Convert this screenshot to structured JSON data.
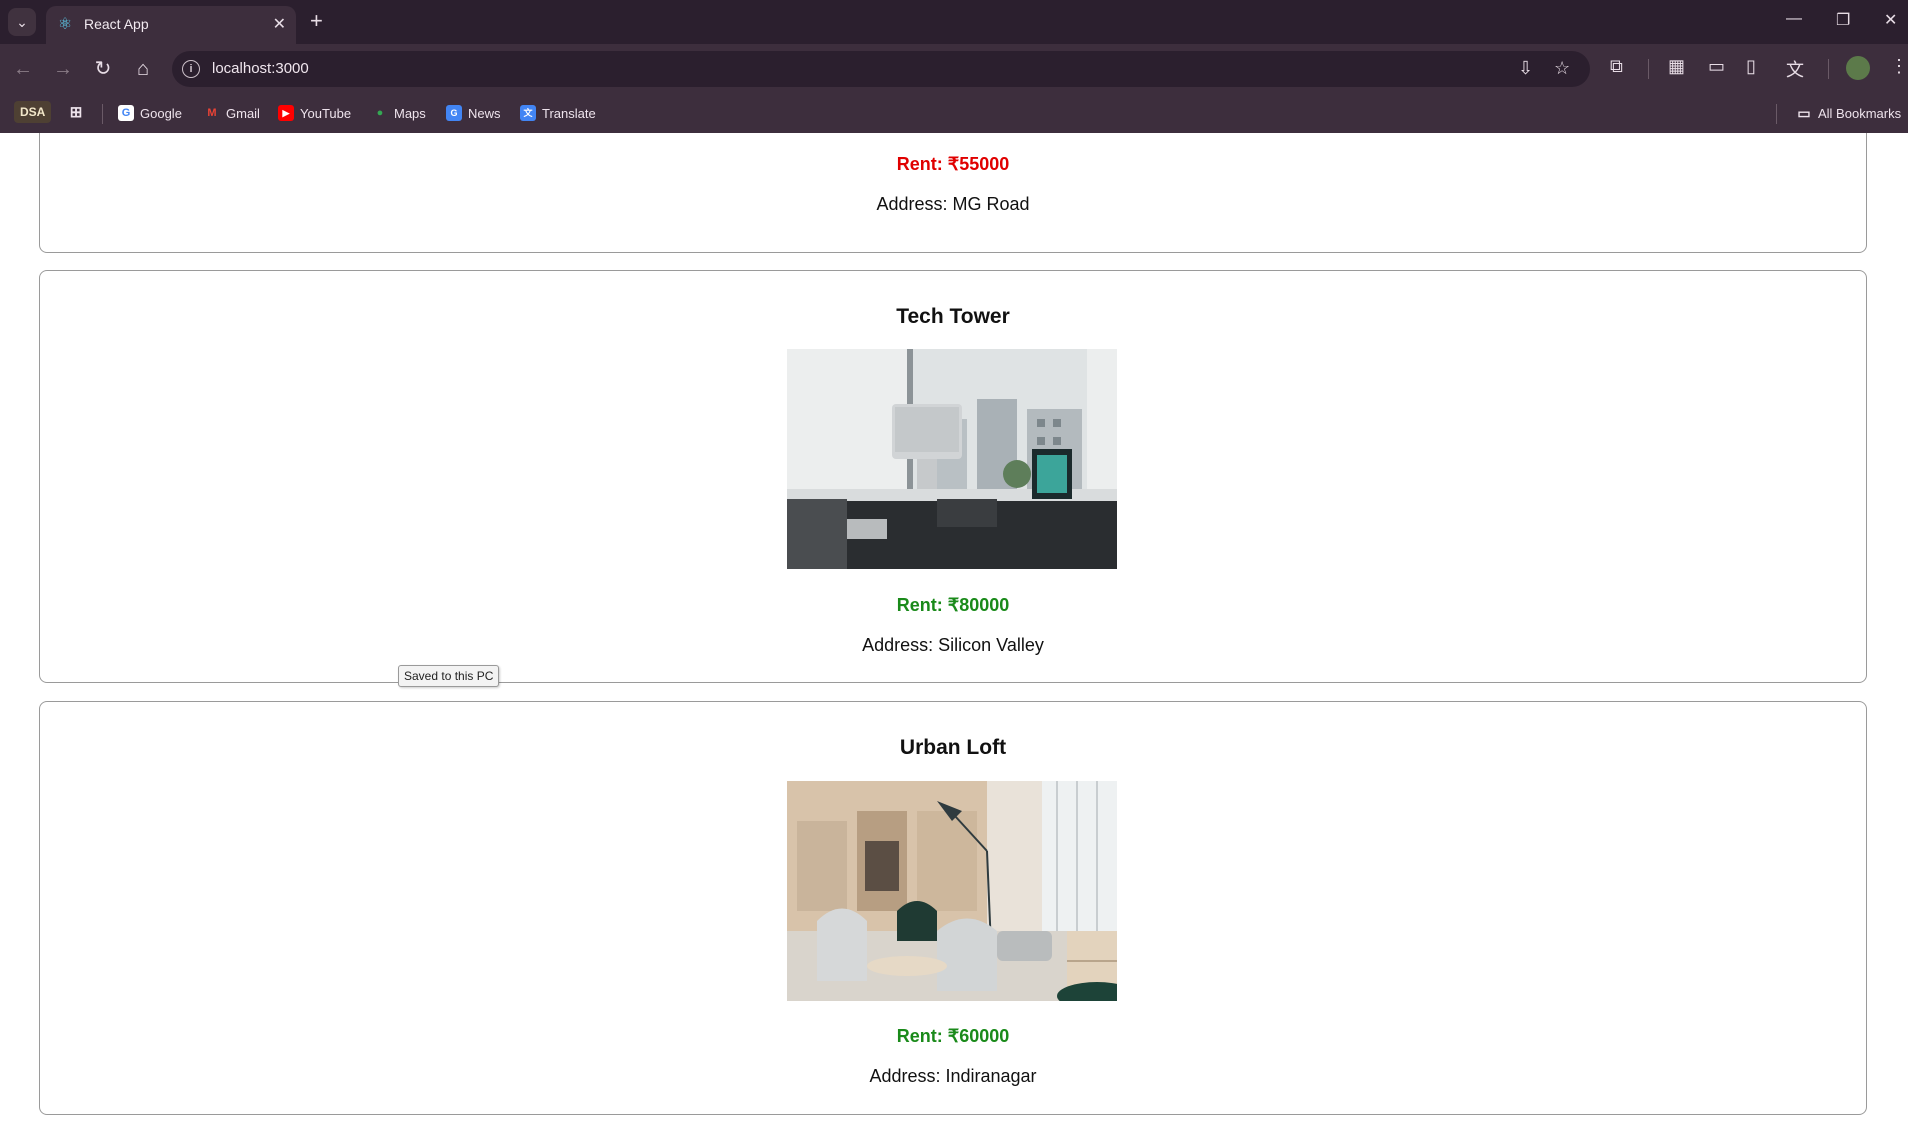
{
  "browser": {
    "tab": {
      "title": "React App"
    },
    "omnibox": {
      "url": "localhost:3000"
    },
    "bookmarks": [
      {
        "label": "DSA"
      },
      {
        "label": "Google"
      },
      {
        "label": "Gmail"
      },
      {
        "label": "YouTube"
      },
      {
        "label": "Maps"
      },
      {
        "label": "News"
      },
      {
        "label": "Translate"
      }
    ],
    "all_bookmarks": "All Bookmarks"
  },
  "cards": [
    {
      "title": "",
      "rent": "Rent: ₹55000",
      "rent_color": "#e00000",
      "address": "Address: MG Road"
    },
    {
      "title": "Tech Tower",
      "rent": "Rent: ₹80000",
      "rent_color": "#1a8a1a",
      "address": "Address: Silicon Valley"
    },
    {
      "title": "Urban Loft",
      "rent": "Rent: ₹60000",
      "rent_color": "#1a8a1a",
      "address": "Address: Indiranagar"
    }
  ],
  "tooltip": {
    "text": "Saved to this PC"
  }
}
